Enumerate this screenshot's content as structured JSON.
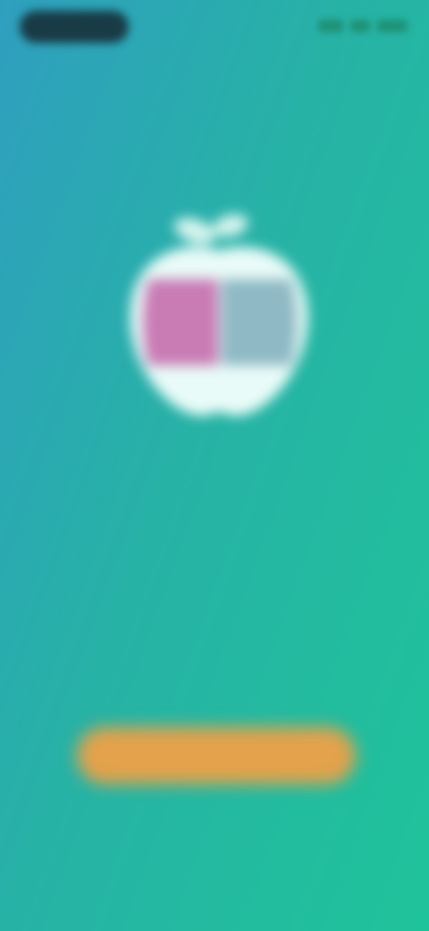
{
  "status_bar": {
    "time": "",
    "icons": [
      "signal-icon",
      "wifi-icon",
      "battery-icon"
    ]
  },
  "logo": {
    "icon": "apple-logo-icon",
    "colors": {
      "body": "#e9fbf8",
      "left_half": "#c97bb4",
      "right_half": "#8fb9c4"
    }
  },
  "tagline": {
    "line1": "",
    "line2": ""
  },
  "small_label": "",
  "primary_button": {
    "label": "",
    "color": "#e3a24b"
  },
  "secondary_link": "",
  "colors": {
    "background_start": "#2f9fbf",
    "background_end": "#1fc39a"
  }
}
